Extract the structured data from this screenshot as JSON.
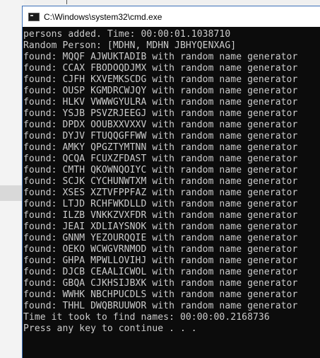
{
  "window": {
    "title": "C:\\Windows\\system32\\cmd.exe",
    "icon": "console-icon"
  },
  "console": {
    "lines": [
      "persons added. Time: 00:00:01.1038710",
      "Random Person: [MDHN, MDHN JBHYQENXAG]",
      "found: MQQF AJWUKTADIB with random name generator",
      "found: CCAX FBODOQDJMX with random name generator",
      "found: CJFH KXVEMKSCDG with random name generator",
      "found: OUSP KGMDRCWJQY with random name generator",
      "found: HLKV VWWWGYULRA with random name generator",
      "found: YSJB PSVZRJEEGJ with random name generator",
      "found: DPDX OOUBXXVXXV with random name generator",
      "found: DYJV FTUQQGFFWW with random name generator",
      "found: AMKY QPGZTYMTNN with random name generator",
      "found: QCQA FCUXZFDAST with random name generator",
      "found: CMTH QKOWNQOIYC with random name generator",
      "found: SCJK CYCHUNWTXM with random name generator",
      "found: XSES XZTVFPPFAZ with random name generator",
      "found: LTJD RCHFWKDLLD with random name generator",
      "found: ILZB VNKKZVXFDR with random name generator",
      "found: JEAI XDLIAYSNOK with random name generator",
      "found: GNNM YEZOURQQIE with random name generator",
      "found: OEKO WCWGVRNMOD with random name generator",
      "found: GHPA MPWLLOVIHJ with random name generator",
      "found: DJCB CEAALICWOL with random name generator",
      "found: GBQA CJKHSIJBXK with random name generator",
      "found: WWHK NBCHPUCDLS with random name generator",
      "found: THHL DWQBRUUWOR with random name generator",
      "Time it took to find names: 00:00:00.2168736",
      "Press any key to continue . . ."
    ]
  },
  "colors": {
    "console_background": "#0c0c0c",
    "console_text": "#cccccc",
    "window_border": "#3c6fb8"
  }
}
